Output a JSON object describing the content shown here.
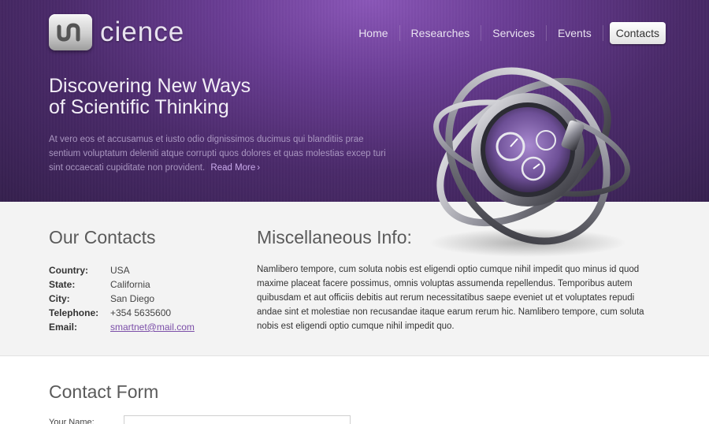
{
  "brand": {
    "logo_text": "cience"
  },
  "nav": {
    "items": [
      {
        "label": "Home"
      },
      {
        "label": "Researches"
      },
      {
        "label": "Services"
      },
      {
        "label": "Events"
      },
      {
        "label": "Contacts",
        "active": true
      }
    ]
  },
  "hero": {
    "title_line1": "Discovering New Ways",
    "title_line2": "of Scientific Thinking",
    "text": "At vero eos et accusamus et iusto odio dignissimos ducimus qui blanditiis prae sentium voluptatum deleniti atque corrupti quos dolores et quas molestias excep turi sint occaecati cupiditate non provident.",
    "read_more": "Read More"
  },
  "contacts": {
    "title": "Our Contacts",
    "rows": [
      {
        "label": "Country:",
        "value": "USA"
      },
      {
        "label": "State:",
        "value": "California"
      },
      {
        "label": "City:",
        "value": "San Diego"
      },
      {
        "label": "Telephone:",
        "value": "+354 5635600"
      },
      {
        "label": "Email:",
        "value": "smartnet@mail.com"
      }
    ]
  },
  "misc": {
    "title": "Miscellaneous Info:",
    "text": "Namlibero tempore, cum soluta nobis est eligendi optio cumque nihil impedit quo minus id quod maxime placeat facere possimus, omnis voluptas assumenda repellendus. Temporibus autem quibusdam et aut officiis debitis aut rerum necessitatibus saepe eveniet ut et voluptates repudi andae sint et molestiae non recusandae itaque earum rerum hic. Namlibero tempore, cum soluta nobis est eligendi optio cumque nihil impedit quo."
  },
  "form": {
    "title": "Contact Form",
    "name_label": "Your Name:"
  },
  "colors": {
    "hero_purple": "#5a3480",
    "accent_link": "#7b4ea8",
    "section_bg": "#f3f3f3"
  }
}
